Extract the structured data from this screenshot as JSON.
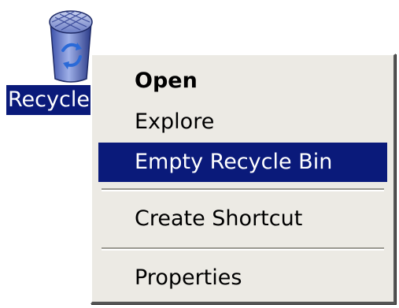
{
  "desktop": {
    "recycle_bin": {
      "icon": "recycle-bin-icon",
      "label": "Recycle Bin"
    }
  },
  "context_menu": {
    "items": [
      {
        "label": "Open",
        "bold": true,
        "highlighted": false
      },
      {
        "label": "Explore",
        "bold": false,
        "highlighted": false
      },
      {
        "label": "Empty Recycle Bin",
        "bold": false,
        "highlighted": true
      },
      {
        "label": "Create Shortcut",
        "bold": false,
        "highlighted": false
      },
      {
        "label": "Properties",
        "bold": false,
        "highlighted": false
      }
    ]
  },
  "colors": {
    "selection": "#0a1a7a",
    "menu_background": "#eceae4"
  }
}
